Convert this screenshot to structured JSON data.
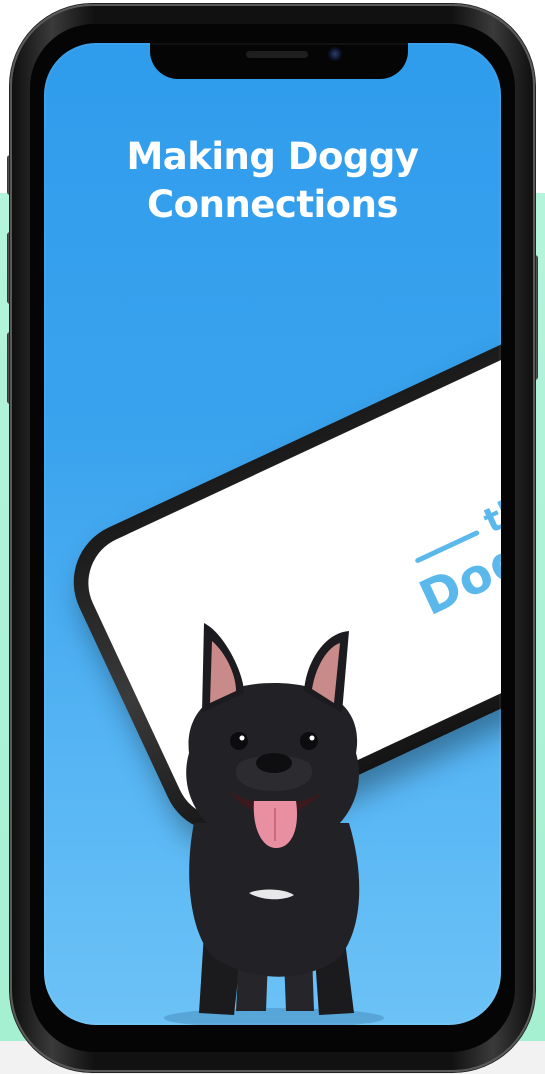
{
  "headline": {
    "line1": "Making Doggy",
    "line2": "Connections"
  },
  "app_logo": {
    "small_word": "the",
    "main_word": "DogHood"
  },
  "colors": {
    "screen_blue": "#2f9cec",
    "mint_backdrop": "#b4f4dc",
    "logo_blue": "#5bb8ea",
    "headline_text": "#ffffff"
  },
  "icons": [
    "front-camera-icon",
    "speaker-grille-icon",
    "dog-logo-icon"
  ]
}
